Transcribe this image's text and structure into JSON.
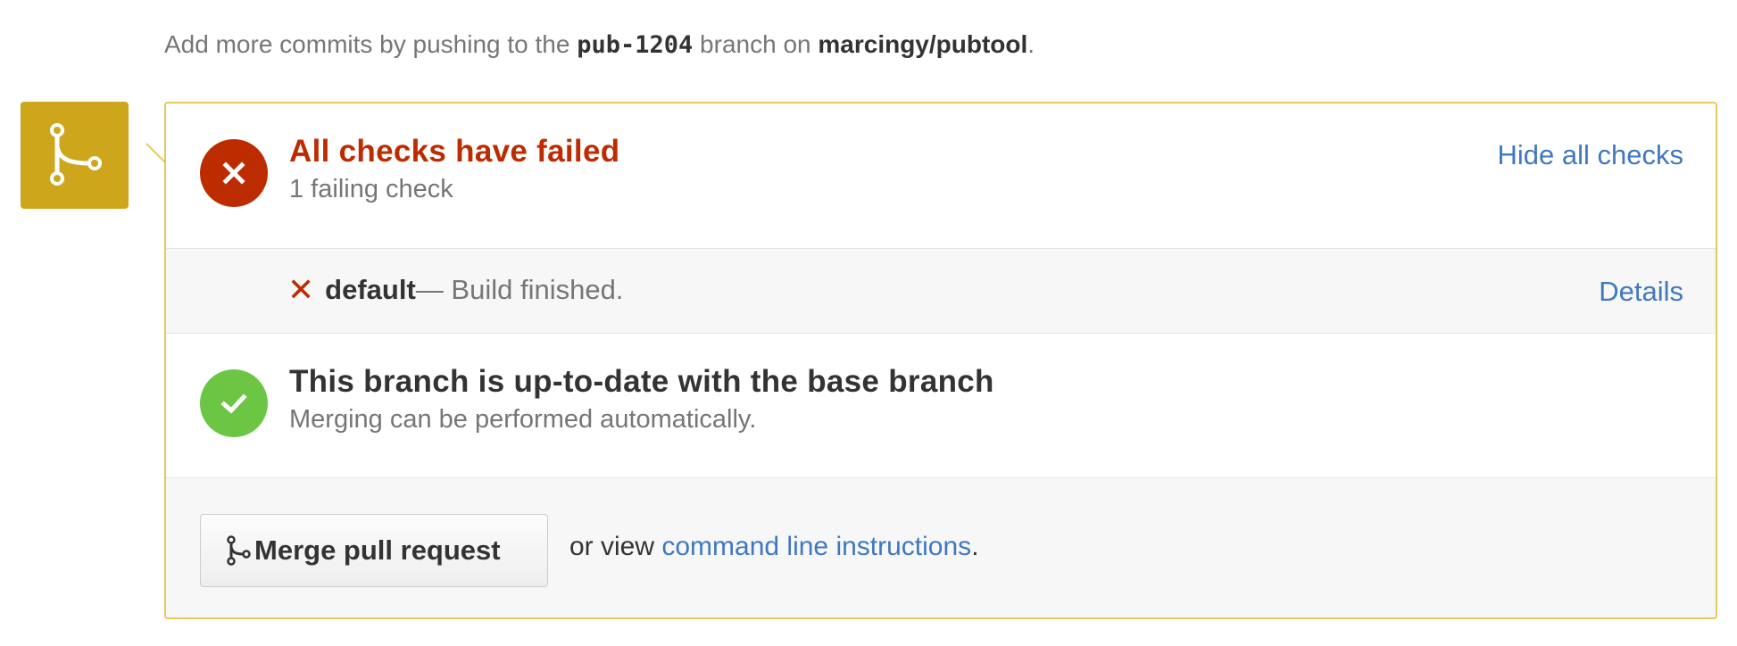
{
  "hint": {
    "prefix": "Add more commits by pushing to the ",
    "branch": "pub-1204",
    "middle": " branch on ",
    "repo": "marcingy/pubtool",
    "suffix": "."
  },
  "checks": {
    "title": "All checks have failed",
    "subtitle": "1 failing check",
    "toggle_label": "Hide all checks",
    "items": [
      {
        "name": "default",
        "description": " — Build finished.",
        "link_label": "Details"
      }
    ]
  },
  "branch_status": {
    "title": "This branch is up-to-date with the base branch",
    "subtitle": "Merging can be performed automatically."
  },
  "merge": {
    "button_label": "Merge pull request",
    "alt_prefix": "or view ",
    "alt_link": "command line instructions",
    "alt_suffix": "."
  },
  "colors": {
    "failure": "#bd2c00",
    "success": "#6cc644",
    "merge_icon_bg": "#cea61b",
    "link": "#4078c0",
    "panel_border": "#e7c95b"
  },
  "icons": {
    "avatar": "git-merge-icon",
    "failed_status": "x-icon",
    "success_status": "check-icon",
    "check_failed": "x-icon",
    "button": "git-merge-icon"
  }
}
